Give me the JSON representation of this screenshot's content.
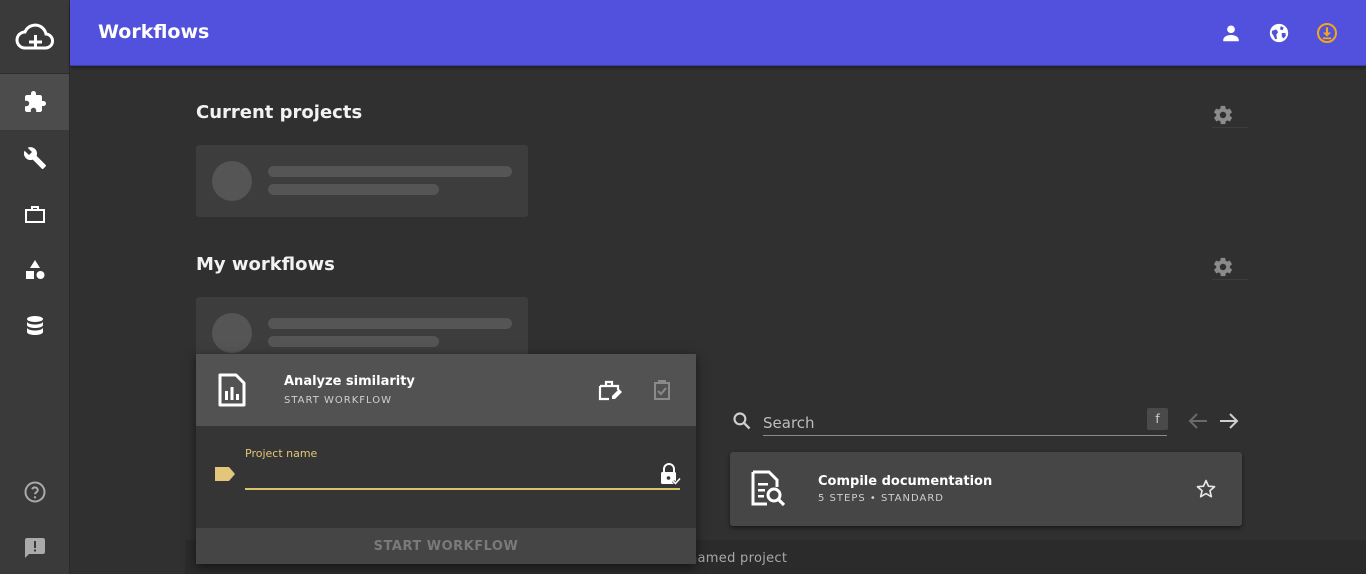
{
  "topbar": {
    "title": "Workflows"
  },
  "sidebar": {
    "items": [
      {
        "name": "workflows",
        "icon": "puzzle-icon",
        "active": true
      },
      {
        "name": "tools",
        "icon": "wrench-icon",
        "active": false
      },
      {
        "name": "projects",
        "icon": "briefcase-icon",
        "active": false
      },
      {
        "name": "shapes",
        "icon": "shapes-icon",
        "active": false
      },
      {
        "name": "database",
        "icon": "database-icon",
        "active": false
      },
      {
        "name": "help",
        "icon": "help-icon",
        "active": false
      },
      {
        "name": "feedback",
        "icon": "feedback-icon",
        "active": false
      }
    ]
  },
  "sections": {
    "current_projects": "Current projects",
    "my_workflows": "My workflows"
  },
  "popup": {
    "title": "Analyze similarity",
    "subtitle": "START WORKFLOW",
    "field_label": "Project name",
    "field_value": "",
    "start_label": "START WORKFLOW"
  },
  "search": {
    "placeholder": "Search",
    "shortcut": "f"
  },
  "workflow_card": {
    "title": "Compile documentation",
    "subtitle": "5 STEPS • STANDARD"
  },
  "bottom_text": "named project",
  "colors": {
    "topbar": "#5151dd",
    "accent": "#d8c26a",
    "download_icon": "#f0a818"
  }
}
